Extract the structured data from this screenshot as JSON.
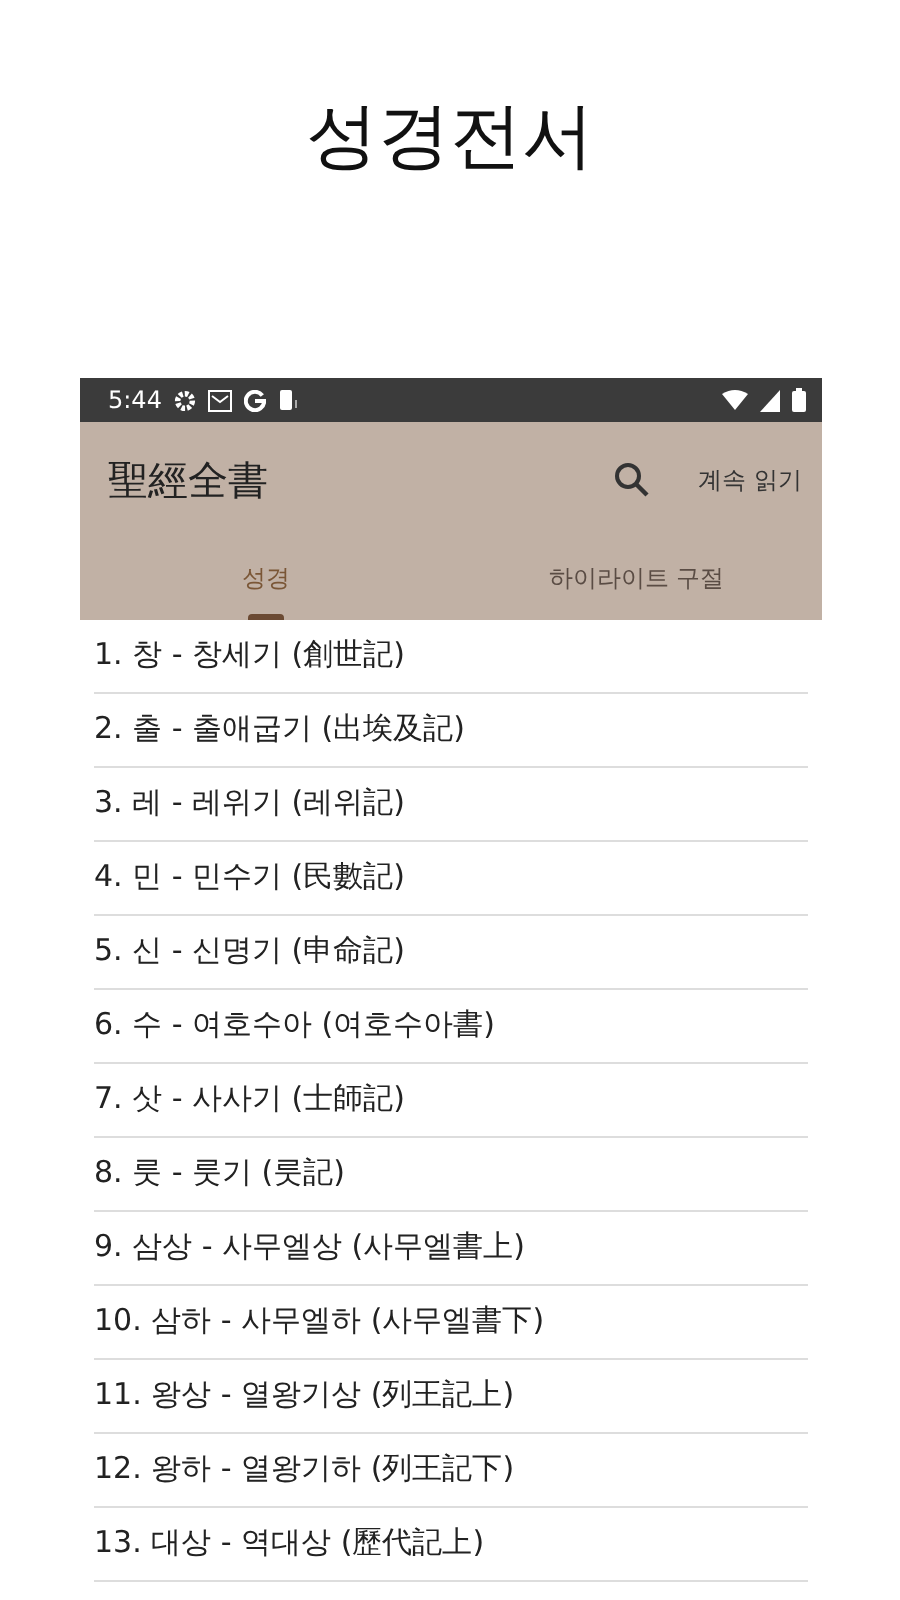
{
  "page_title": "성경전서",
  "status_bar": {
    "time": "5:44"
  },
  "app_bar": {
    "title": "聖經全書",
    "action": "계속 읽기"
  },
  "tabs": [
    {
      "label": "성경",
      "selected": true
    },
    {
      "label": "하이라이트 구절",
      "selected": false
    }
  ],
  "books": [
    "1. 창 - 창세기 (創世記)",
    "2. 출 - 출애굽기 (出埃及記)",
    "3. 레 - 레위기 (레위記)",
    "4. 민 - 민수기 (民數記)",
    "5. 신 - 신명기 (申命記)",
    "6. 수 - 여호수아 (여호수아書)",
    "7. 삿 - 사사기 (士師記)",
    "8. 룻 - 룻기 (룻記)",
    "9. 삼상 - 사무엘상 (사무엘書上)",
    "10. 삼하 - 사무엘하 (사무엘書下)",
    "11. 왕상 - 열왕기상 (列王記上)",
    "12. 왕하 - 열왕기하 (列王記下)",
    "13. 대상 - 역대상 (歷代記上)"
  ]
}
